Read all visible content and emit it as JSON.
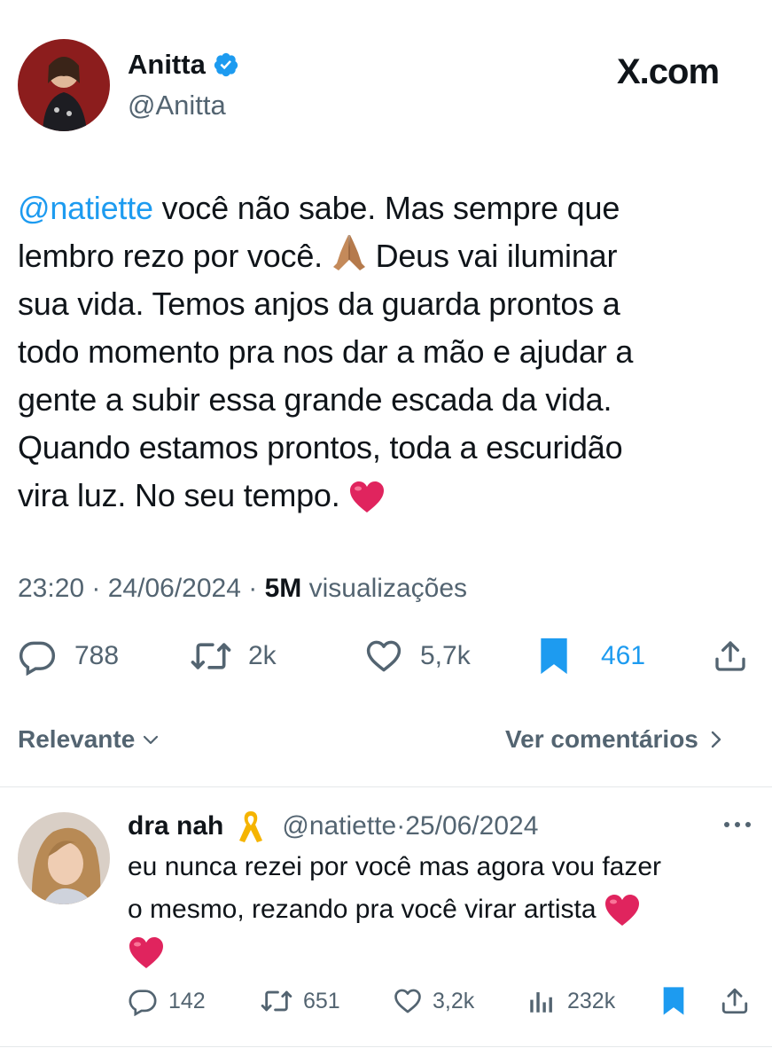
{
  "tweet": {
    "author": {
      "name": "Anitta",
      "handle": "@Anitta",
      "verified": true
    },
    "site_logo": "X.com",
    "text_mention": "@natiette",
    "text_lines": [
      " você não sabe. Mas sempre que",
      "lembro rezo por você. ",
      "  Deus vai iluminar",
      "sua vida. Temos anjos da guarda prontos a",
      "todo momento pra nos dar a mão e ajudar a",
      "gente a subir essa grande escada da vida.",
      "Quando estamos prontos, toda a escuridão",
      "vira luz. No seu tempo. "
    ],
    "time": "23:20",
    "date": "24/06/2024",
    "views_count": "5M",
    "views_label": "visualizações",
    "actions": {
      "replies": "788",
      "retweets": "2k",
      "likes": "5,7k",
      "bookmarks": "461"
    }
  },
  "sort": {
    "label": "Relevante",
    "comments_link": "Ver comentários"
  },
  "reply": {
    "author_name": "dra nah",
    "handle": "@natiette",
    "date": "25/06/2024",
    "text_lines": [
      "eu nunca rezei por você mas agora vou fazer",
      "o mesmo, rezando pra você virar artista "
    ],
    "actions": {
      "replies": "142",
      "retweets": "651",
      "likes": "3,2k",
      "views": "232k"
    }
  },
  "colors": {
    "accent": "#1d9bf0",
    "secondary_text": "#536471",
    "heart_emoji": "#e0245e",
    "bookmark_active": "#1d9bf0"
  },
  "icons": [
    "verified-badge-icon",
    "reply-icon",
    "retweet-icon",
    "like-icon",
    "bookmark-icon",
    "share-icon",
    "chevron-down-icon",
    "chevron-right-icon",
    "more-icon",
    "views-icon",
    "ribbon-icon",
    "praying-hands-icon",
    "heart-emoji-icon"
  ]
}
